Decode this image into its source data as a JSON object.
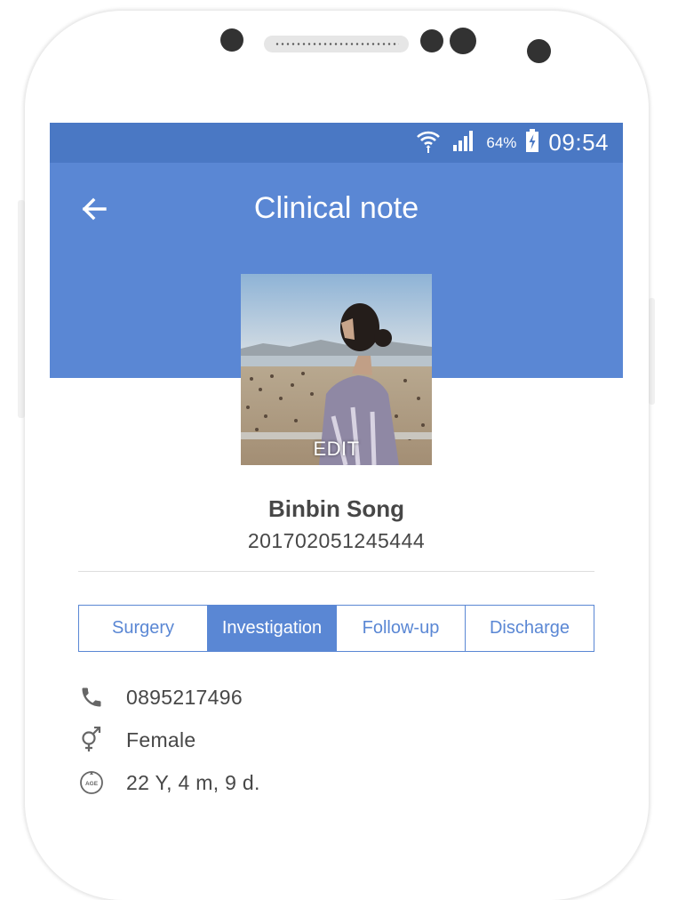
{
  "status_bar": {
    "battery_percent": "64%",
    "time": "09:54",
    "icons": [
      "wifi-icon",
      "signal-icon",
      "battery-charging-icon"
    ]
  },
  "app_bar": {
    "title": "Clinical note",
    "back_icon": "arrow-left-icon"
  },
  "profile": {
    "edit_label": "EDIT",
    "name": "Binbin Song",
    "id": "201702051245444"
  },
  "tabs": [
    {
      "label": "Surgery",
      "active": false
    },
    {
      "label": "Investigation",
      "active": true
    },
    {
      "label": "Follow-up",
      "active": false
    },
    {
      "label": "Discharge",
      "active": false
    }
  ],
  "details": {
    "phone": "0895217496",
    "gender": "Female",
    "age": "22 Y, 4 m, 9 d.",
    "age_icon_text": "AGE"
  },
  "colors": {
    "status_bar": "#4a78c4",
    "primary": "#5a87d4",
    "text": "#474747",
    "icon": "#666666"
  }
}
